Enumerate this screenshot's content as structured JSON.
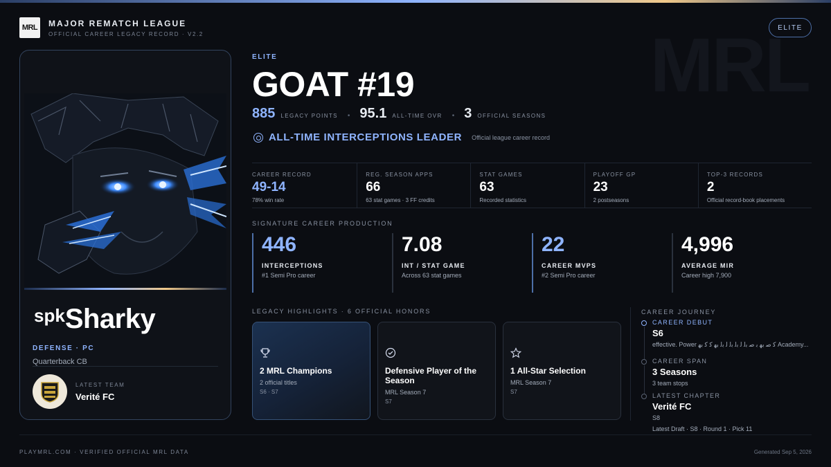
{
  "colors": {
    "accent": "#8fb4ff",
    "gold": "#f1c98a",
    "bg": "#0b0d12"
  },
  "header": {
    "logo_text": "MRL",
    "league_name": "MAJOR REMATCH LEAGUE",
    "subtitle": "OFFICIAL CAREER LEGACY RECORD · V2.2",
    "tier_badge": "ELITE",
    "watermark": "MRL"
  },
  "card": {
    "name_prefix": "spk",
    "name": "Sharky",
    "position": "DEFENSE · PC",
    "role": "Quarterback CB",
    "team_label": "LATEST TEAM",
    "team_name": "Verité FC"
  },
  "hero": {
    "tier": "ELITE",
    "title": "GOAT #19",
    "legacy_points": "885",
    "legacy_points_label": "LEGACY POINTS",
    "ovr": "95.1",
    "ovr_label": "ALL-TIME OVR",
    "seasons": "3",
    "seasons_label": "OFFICIAL SEASONS",
    "leader_title": "ALL-TIME INTERCEPTIONS LEADER",
    "leader_note": "Official league career record"
  },
  "records": [
    {
      "label": "CAREER RECORD",
      "value": "49-14",
      "sub": "78% win rate"
    },
    {
      "label": "REG. SEASON APPS",
      "value": "66",
      "sub": "63 stat games · 3 FF credits"
    },
    {
      "label": "STAT GAMES",
      "value": "63",
      "sub": "Recorded statistics"
    },
    {
      "label": "PLAYOFF GP",
      "value": "23",
      "sub": "2 postseasons"
    },
    {
      "label": "TOP-3 RECORDS",
      "value": "2",
      "sub": "Official record-book placements"
    }
  ],
  "production": {
    "section_label": "SIGNATURE CAREER PRODUCTION",
    "items": [
      {
        "value": "446",
        "label": "INTERCEPTIONS",
        "sub": "#1 Semi Pro career"
      },
      {
        "value": "7.08",
        "label": "INT / STAT GAME",
        "sub": "Across 63 stat games"
      },
      {
        "value": "22",
        "label": "CAREER MVPS",
        "sub": "#2 Semi Pro career"
      },
      {
        "value": "4,996",
        "label": "AVERAGE MIR",
        "sub": "Career high 7,900"
      }
    ]
  },
  "honors": {
    "section_label": "LEGACY HIGHLIGHTS · 6 OFFICIAL HONORS",
    "items": [
      {
        "icon": "trophy-icon",
        "title": "2 MRL Champions",
        "sub": "2 official titles",
        "tag": "S6 · S7"
      },
      {
        "icon": "check-circle-icon",
        "title": "Defensive Player of the Season",
        "sub": "MRL Season 7",
        "tag": "S7"
      },
      {
        "icon": "star-icon",
        "title": "1 All-Star Selection",
        "sub": "MRL Season 7",
        "tag": "S7"
      }
    ]
  },
  "journey": {
    "section_label": "CAREER JOURNEY",
    "debut_label": "CAREER DEBUT",
    "debut_value": "S6",
    "debut_sub": "effective. Power ﮐ ﺻ ﺑﮭ ﺑ ﺻ ﺑﻟ ﻟ ﺑﻟ ﺑﻟ ﻟ ﺑﻟ ﺑﮭ ﮐ ﮐ ﺑﮭ Academy...",
    "span_label": "CAREER SPAN",
    "span_value": "3 Seasons",
    "span_sub": "3 team stops",
    "latest_label": "LATEST CHAPTER",
    "latest_value": "Verité FC",
    "latest_sub": "S8",
    "latest_draft": "Latest Draft · S8 · Round 1 · Pick 11"
  },
  "footer": {
    "left": "PLAYMRL.COM · VERIFIED OFFICIAL MRL DATA",
    "right": "Generated Sep 5, 2026"
  }
}
